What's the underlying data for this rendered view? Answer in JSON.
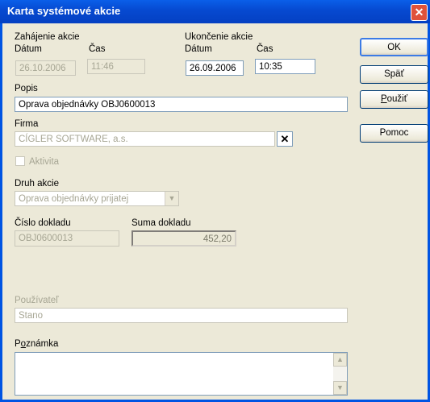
{
  "window": {
    "title": "Karta systémové akcie",
    "close_glyph": "✕"
  },
  "start": {
    "section_label": "Zahájenie akcie",
    "date_label": "Dátum",
    "time_label": "Čas",
    "date": "26.10.2006",
    "time": "11:46"
  },
  "end": {
    "section_label": "Ukončenie akcie",
    "date_label": "Dátum",
    "time_label": "Čas",
    "date": "26.09.2006",
    "time": "10:35"
  },
  "popis": {
    "label": "Popis",
    "value": "Oprava objednávky OBJ0600013"
  },
  "firma": {
    "label": "Firma",
    "value": "CÍGLER SOFTWARE, a.s.",
    "clear_glyph": "✕"
  },
  "aktivita": {
    "label": "Aktivita",
    "checked": false
  },
  "druh": {
    "label": "Druh akcie",
    "value": "Oprava objednávky prijatej"
  },
  "cislo": {
    "label": "Číslo dokladu",
    "value": "OBJ0600013"
  },
  "suma": {
    "label": "Suma dokladu",
    "value": "452,20"
  },
  "pouzivatel": {
    "label": "Používateľ",
    "value": "Stano"
  },
  "poznamka": {
    "label_pre": "P",
    "label_acc": "o",
    "label_post": "známka",
    "value": ""
  },
  "buttons": {
    "ok": "OK",
    "back": "Späť",
    "use_acc": "P",
    "use_rest": "oužiť",
    "help": "Pomoc"
  },
  "icons": {
    "window_close": "close-icon",
    "firma_clear": "clear-x-icon",
    "combo_arrow": "chevron-down-icon",
    "scroll_up": "arrow-up-icon",
    "scroll_down": "arrow-down-icon"
  },
  "colors": {
    "titlebar": "#0a5fe9",
    "face": "#ece9d8",
    "field_border": "#7f9db9",
    "disabled_text": "#a7a694",
    "close_red": "#e0523a"
  }
}
